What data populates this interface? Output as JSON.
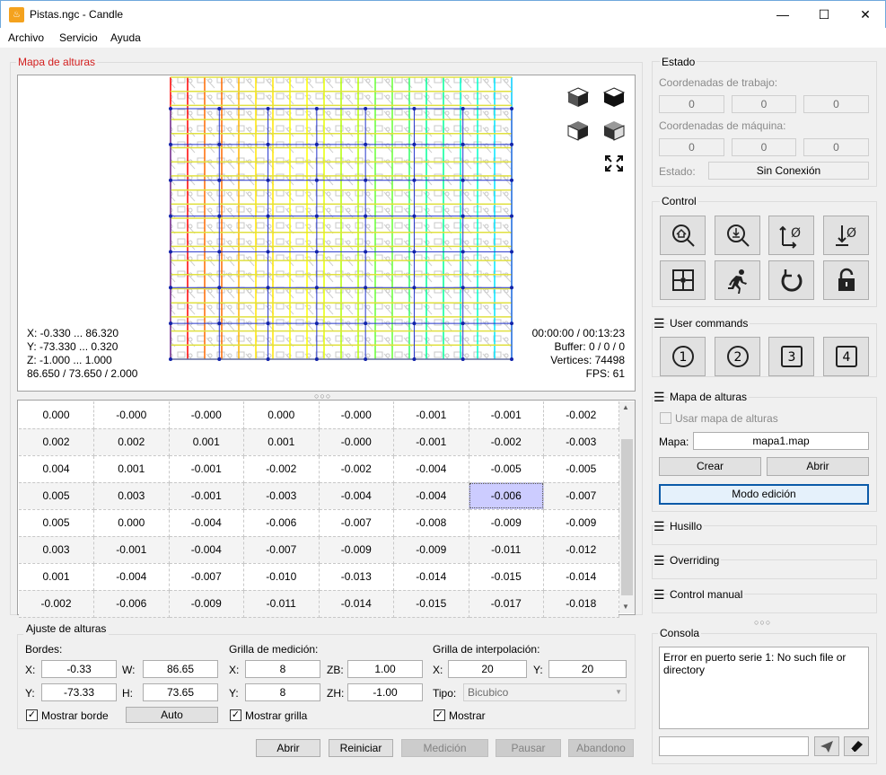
{
  "window": {
    "title": "Pistas.ngc - Candle",
    "icon": "app-icon",
    "minimize": "—",
    "maximize": "☐",
    "close": "✕"
  },
  "menu": {
    "items": [
      "Archivo",
      "Servicio",
      "Ayuda"
    ]
  },
  "heightmap_view": {
    "title": "Mapa de alturas",
    "info_left": [
      "X: -0.330 ... 86.320",
      "Y: -73.330 ... 0.320",
      "Z: -1.000 ... 1.000",
      "86.650 / 73.650 / 2.000"
    ],
    "info_right": [
      "00:00:00 / 00:13:23",
      "Buffer: 0 / 0 / 0",
      "Vertices: 74498",
      "FPS: 61"
    ]
  },
  "splitter_dots": "○○○",
  "table": {
    "rows": [
      [
        "0.000",
        "-0.000",
        "-0.000",
        "0.000",
        "-0.000",
        "-0.001",
        "-0.001",
        "-0.002"
      ],
      [
        "0.002",
        "0.002",
        "0.001",
        "0.001",
        "-0.000",
        "-0.001",
        "-0.002",
        "-0.003"
      ],
      [
        "0.004",
        "0.001",
        "-0.001",
        "-0.002",
        "-0.002",
        "-0.004",
        "-0.005",
        "-0.005"
      ],
      [
        "0.005",
        "0.003",
        "-0.001",
        "-0.003",
        "-0.004",
        "-0.004",
        "-0.006",
        "-0.007"
      ],
      [
        "0.005",
        "0.000",
        "-0.004",
        "-0.006",
        "-0.007",
        "-0.008",
        "-0.009",
        "-0.009"
      ],
      [
        "0.003",
        "-0.001",
        "-0.004",
        "-0.007",
        "-0.009",
        "-0.009",
        "-0.011",
        "-0.012"
      ],
      [
        "0.001",
        "-0.004",
        "-0.007",
        "-0.010",
        "-0.013",
        "-0.014",
        "-0.015",
        "-0.014"
      ],
      [
        "-0.002",
        "-0.006",
        "-0.009",
        "-0.011",
        "-0.014",
        "-0.015",
        "-0.017",
        "-0.018"
      ]
    ]
  },
  "ajuste": {
    "title": "Ajuste de alturas",
    "bordes": {
      "label": "Bordes:",
      "x_label": "X:",
      "x": "-0.33",
      "w_label": "W:",
      "w": "86.65",
      "y_label": "Y:",
      "y": "-73.33",
      "h_label": "H:",
      "h": "73.65",
      "show_label": "Mostrar borde",
      "auto": "Auto"
    },
    "grilla_medicion": {
      "label": "Grilla de medición:",
      "x_label": "X:",
      "x": "8",
      "zb_label": "ZB:",
      "zb": "1.00",
      "y_label": "Y:",
      "y": "8",
      "zh_label": "ZH:",
      "zh": "-1.00",
      "show_label": "Mostrar grilla"
    },
    "grilla_interpolacion": {
      "label": "Grilla de interpolación:",
      "x_label": "X:",
      "x": "20",
      "y_label": "Y:",
      "y": "20",
      "tipo_label": "Tipo:",
      "tipo": "Bicubico",
      "show_label": "Mostrar"
    },
    "buttons": {
      "abrir": "Abrir",
      "reiniciar": "Reiniciar",
      "medicion": "Medición",
      "pausar": "Pausar",
      "abandono": "Abandono"
    }
  },
  "estado": {
    "title": "Estado",
    "coord_trabajo_label": "Coordenadas de trabajo:",
    "coord_trabajo": [
      "0",
      "0",
      "0"
    ],
    "coord_maquina_label": "Coordenadas de máquina:",
    "coord_maquina": [
      "0",
      "0",
      "0"
    ],
    "estado_label": "Estado:",
    "estado_value": "Sin Conexión"
  },
  "control": {
    "title": "Control"
  },
  "user_commands": {
    "title": "User commands",
    "buttons": [
      "1",
      "2",
      "3",
      "4"
    ]
  },
  "mapa_panel": {
    "title": "Mapa de alturas",
    "usar_label": "Usar mapa de alturas",
    "mapa_label": "Mapa:",
    "mapa_value": "mapa1.map",
    "crear": "Crear",
    "abrir": "Abrir",
    "modo_edicion": "Modo edición"
  },
  "collapsed": {
    "husillo": "Husillo",
    "overriding": "Overriding",
    "control_manual": "Control manual"
  },
  "consola": {
    "title": "Consola",
    "text": "Error en puerto serie 1: No such file or directory",
    "input_value": ""
  },
  "colors": {
    "accent_red": "#d32020",
    "selected_cell": "#ccccff",
    "window_border": "#6fa8dc"
  }
}
